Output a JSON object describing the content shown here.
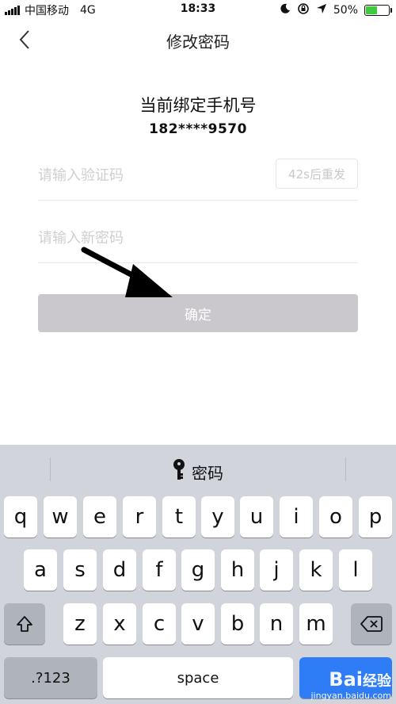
{
  "status_bar": {
    "carrier": "中国移动",
    "network": "4G",
    "time": "18:33",
    "battery": "50%",
    "battery_level": 0.5,
    "icons": [
      "signal-icon",
      "moon-icon",
      "orientation-lock-icon",
      "location-arrow-icon",
      "battery-icon"
    ]
  },
  "nav": {
    "title": "修改密码",
    "back_icon": "chevron-left-icon"
  },
  "content": {
    "heading": "当前绑定手机号",
    "phone": "182****9570",
    "code_placeholder": "请输入验证码",
    "resend_label": "42s后重发",
    "password_placeholder": "请输入新密码",
    "confirm_label": "确定"
  },
  "keyboard": {
    "suggestion": "密码",
    "suggestion_icon": "key-icon",
    "row1": [
      "q",
      "w",
      "e",
      "r",
      "t",
      "y",
      "u",
      "i",
      "o",
      "p"
    ],
    "row2": [
      "a",
      "s",
      "d",
      "f",
      "g",
      "h",
      "j",
      "k",
      "l"
    ],
    "row3": [
      "z",
      "x",
      "c",
      "v",
      "b",
      "n",
      "m"
    ],
    "num_label": ".?123",
    "space_label": "space",
    "shift_icon": "shift-icon",
    "delete_icon": "backspace-icon"
  },
  "watermark": {
    "brand": "Bai",
    "brand_tail": "经验",
    "url": "jingyan.baidu.com"
  }
}
